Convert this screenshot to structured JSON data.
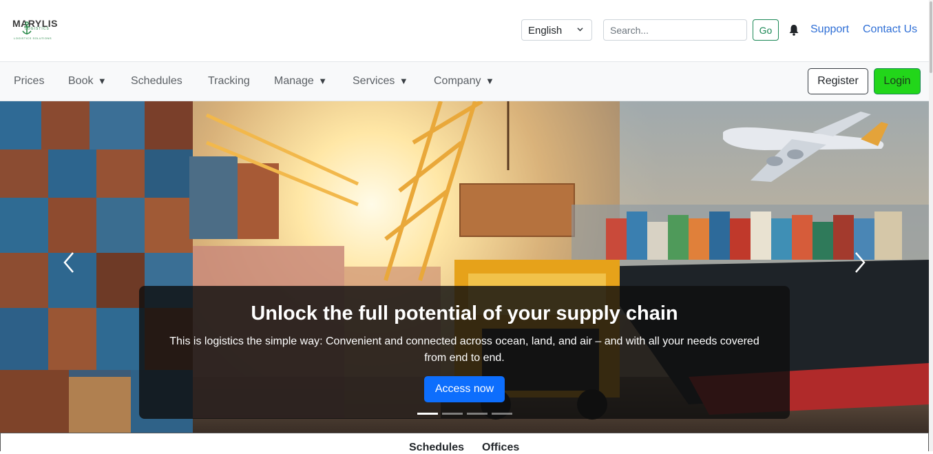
{
  "brand": {
    "logo_text": "MARYLIS",
    "logo_sub": "LOGISTICS",
    "logo_tag": "LOGISTICS SOLUTIONS"
  },
  "header": {
    "language": "English",
    "search_placeholder": "Search...",
    "go_label": "Go",
    "support_label": "Support",
    "contact_label": "Contact Us"
  },
  "nav": {
    "items": [
      {
        "label": "Prices",
        "caret": ""
      },
      {
        "label": "Book",
        "caret": "▼"
      },
      {
        "label": "Schedules",
        "caret": ""
      },
      {
        "label": "Tracking",
        "caret": ""
      },
      {
        "label": "Manage",
        "caret": "▼"
      },
      {
        "label": "Services",
        "caret": "▼"
      },
      {
        "label": "Company",
        "caret": "▼"
      }
    ],
    "register_label": "Register",
    "login_label": "Login"
  },
  "hero": {
    "title": "Unlock the full potential of your supply chain",
    "text": "This is logistics the simple way: Convenient and connected across ocean, land, and air – and with all your needs covered from end to end.",
    "cta_label": "Access now",
    "slide_count": 4,
    "active_slide": 0
  },
  "bottom_tabs": [
    "Schedules",
    "Offices"
  ],
  "colors": {
    "link": "#2f6fd6",
    "go_green": "#198754",
    "login_green": "#22d61a",
    "cta_blue": "#0d6efd"
  }
}
